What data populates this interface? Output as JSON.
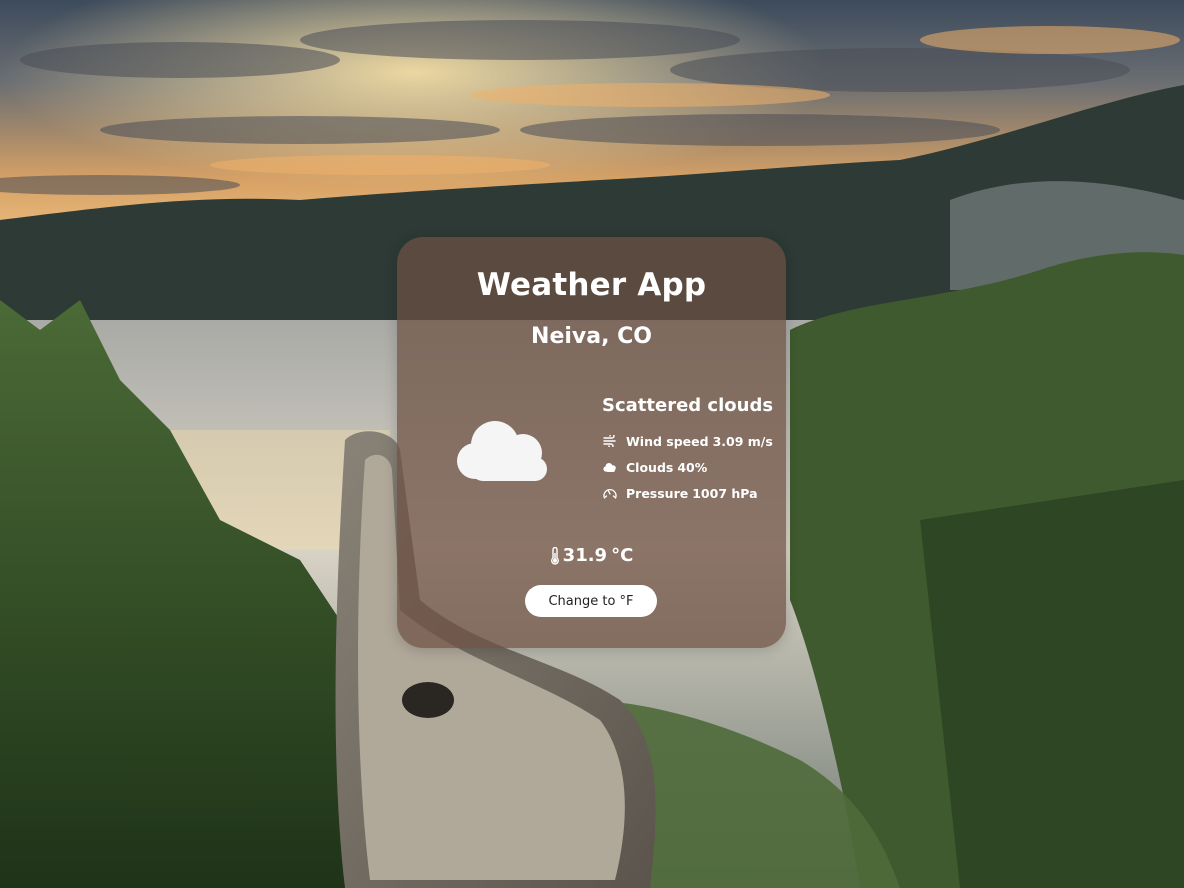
{
  "app": {
    "title": "Weather App"
  },
  "location": {
    "city": "Neiva, CO"
  },
  "weather": {
    "description": "Scattered clouds",
    "icon": "cloud-icon",
    "wind_label": "Wind speed",
    "wind_value": "3.09 m/s",
    "clouds_label": "Clouds",
    "clouds_value": "40%",
    "pressure_label": "Pressure",
    "pressure_value": "1007 hPa",
    "temperature": "31.9",
    "temperature_unit": "°C"
  },
  "controls": {
    "toggle_unit_label": "Change to °F"
  },
  "colors": {
    "card_background": "#6e5042",
    "text": "#ffffff",
    "button_background": "#ffffff",
    "button_text": "#222222"
  }
}
